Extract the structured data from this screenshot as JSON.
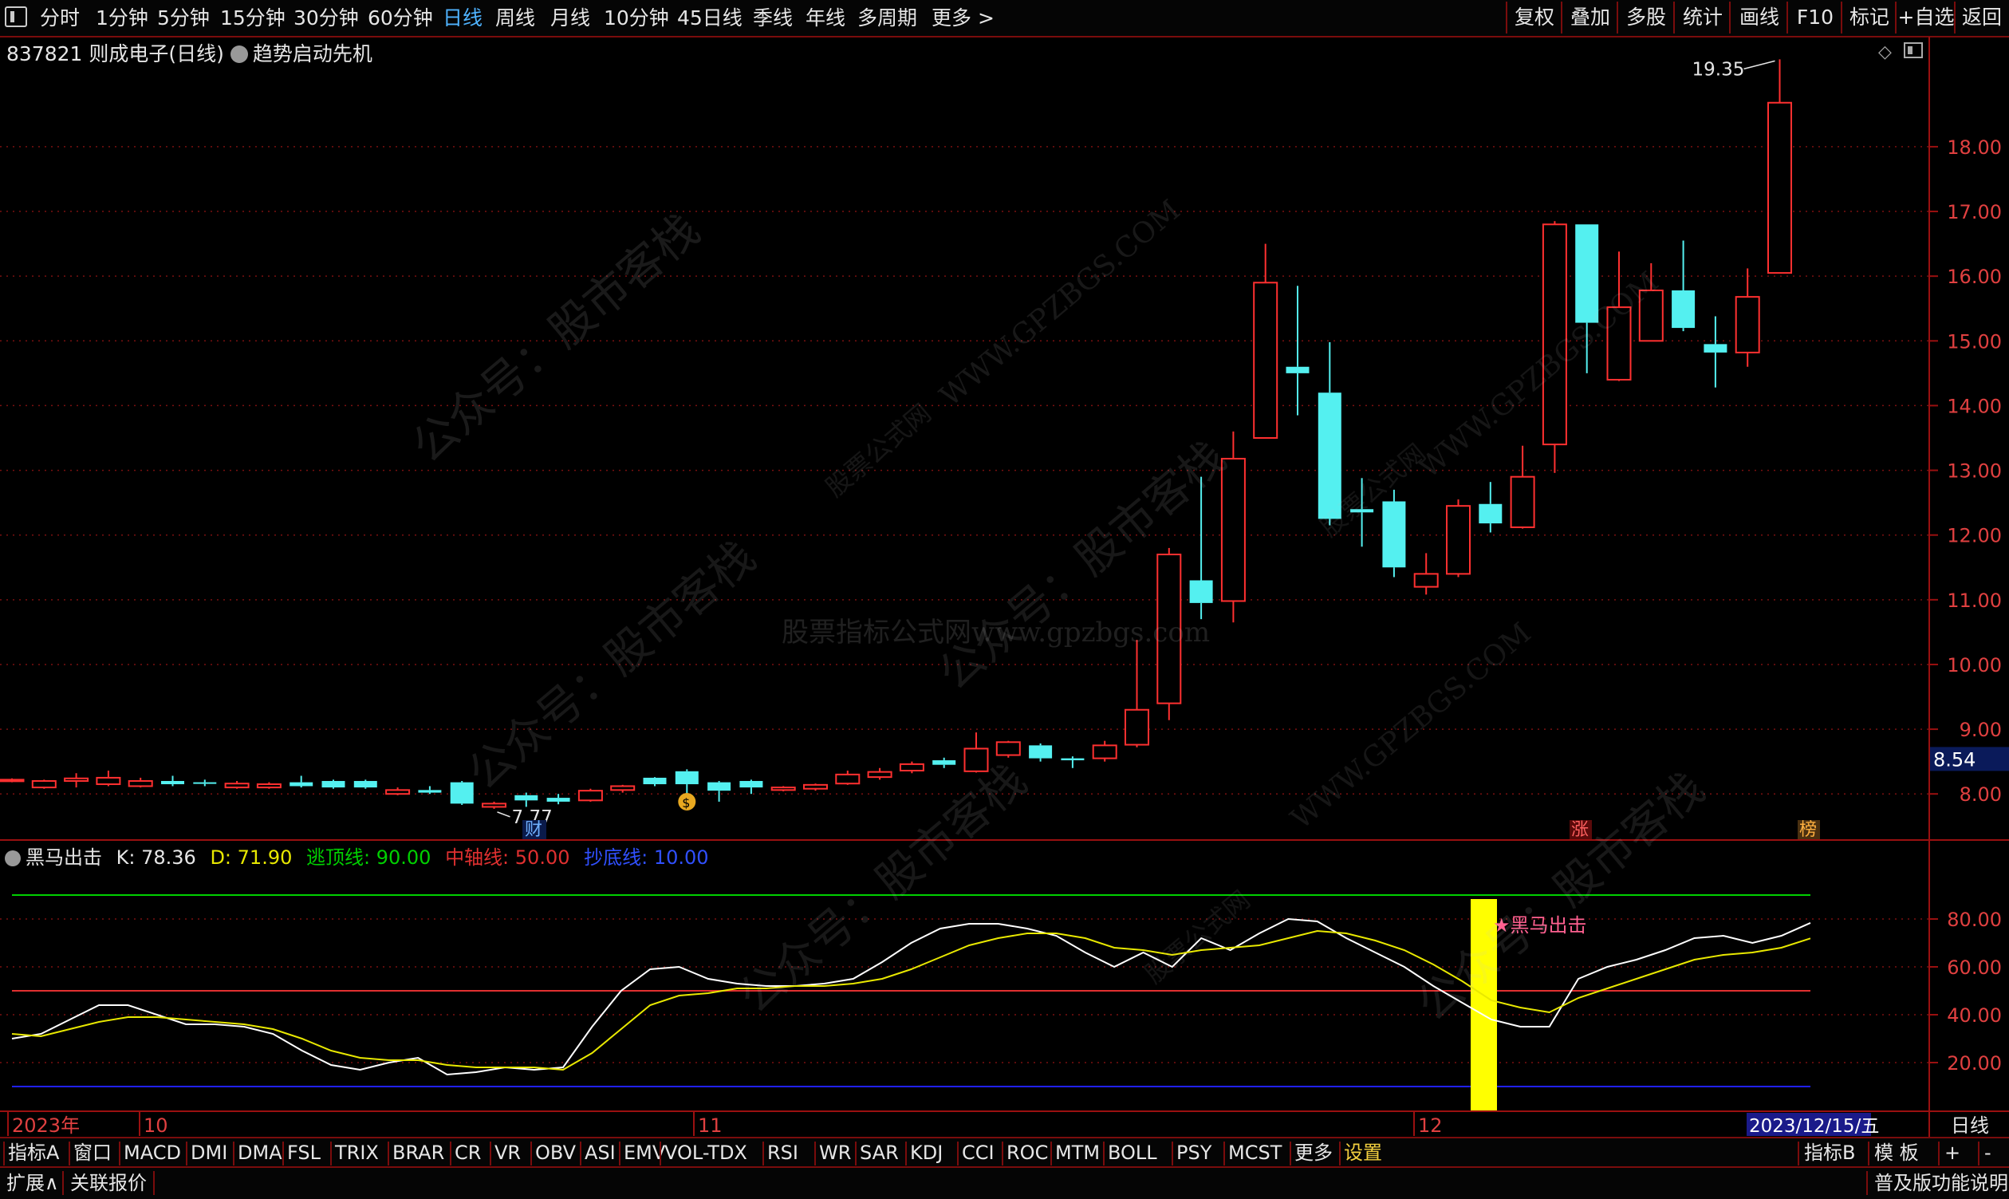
{
  "toolbar": {
    "periods": [
      "分时",
      "1分钟",
      "5分钟",
      "15分钟",
      "30分钟",
      "60分钟",
      "日线",
      "周线",
      "月线",
      "10分钟",
      "45日线",
      "季线",
      "年线",
      "多周期",
      "更多 >"
    ],
    "active_period": "日线",
    "right_buttons": [
      "复权",
      "叠加",
      "多股",
      "统计",
      "画线",
      "F10",
      "标记",
      "+自选",
      "返回"
    ]
  },
  "stock": {
    "title": "837821 则成电子(日线)",
    "indicator_name": "趋势启动先机",
    "current_price_label": "8.54"
  },
  "main_chart": {
    "price_axis": [
      "18.00",
      "17.00",
      "16.00",
      "15.00",
      "14.00",
      "13.00",
      "12.00",
      "11.00",
      "10.00",
      "9.00",
      "8.00"
    ],
    "high_label": "19.35",
    "low_label": "7.77",
    "markers": {
      "cai": "财",
      "zhang": "涨",
      "bang": "榜"
    }
  },
  "indicator": {
    "name": "黑马出击",
    "k_label": "K: 78.36",
    "d_label": "D: 71.90",
    "top_line_label": "逃顶线: 90.00",
    "mid_line_label": "中轴线: 50.00",
    "bottom_line_label": "抄底线: 10.00",
    "axis": [
      "80.00",
      "60.00",
      "40.00",
      "20.00"
    ],
    "signal_label": "★黑马出击",
    "colors": {
      "k": "#ffffff",
      "d": "#e8e800",
      "top": "#00d000",
      "mid": "#e03030",
      "bottom": "#2020ff",
      "signal": "#ffff00"
    }
  },
  "time_axis": {
    "labels": [
      "2023年",
      "10",
      "11",
      "12"
    ],
    "cursor_date": "2023/12/15/五",
    "period_label": "日线"
  },
  "chart_data": [
    {
      "type": "candlestick",
      "title": "",
      "ylim": [
        7.3,
        19.7
      ],
      "candles": [
        {
          "o": 8.2,
          "c": 8.22,
          "h": 8.24,
          "l": 8.18,
          "up": true
        },
        {
          "o": 8.1,
          "c": 8.2,
          "h": 8.22,
          "l": 8.08,
          "up": true
        },
        {
          "o": 8.2,
          "c": 8.24,
          "h": 8.32,
          "l": 8.1,
          "up": true
        },
        {
          "o": 8.15,
          "c": 8.25,
          "h": 8.36,
          "l": 8.12,
          "up": true
        },
        {
          "o": 8.12,
          "c": 8.2,
          "h": 8.25,
          "l": 8.1,
          "up": true
        },
        {
          "o": 8.2,
          "c": 8.15,
          "h": 8.28,
          "l": 8.12,
          "up": false
        },
        {
          "o": 8.18,
          "c": 8.16,
          "h": 8.22,
          "l": 8.12,
          "up": false
        },
        {
          "o": 8.1,
          "c": 8.16,
          "h": 8.2,
          "l": 8.08,
          "up": true
        },
        {
          "o": 8.1,
          "c": 8.15,
          "h": 8.18,
          "l": 8.08,
          "up": true
        },
        {
          "o": 8.18,
          "c": 8.12,
          "h": 8.28,
          "l": 8.1,
          "up": false
        },
        {
          "o": 8.2,
          "c": 8.1,
          "h": 8.22,
          "l": 8.08,
          "up": false
        },
        {
          "o": 8.2,
          "c": 8.1,
          "h": 8.22,
          "l": 8.08,
          "up": false
        },
        {
          "o": 8.0,
          "c": 8.06,
          "h": 8.1,
          "l": 7.98,
          "up": true
        },
        {
          "o": 8.06,
          "c": 8.02,
          "h": 8.12,
          "l": 8.0,
          "up": false
        },
        {
          "o": 8.18,
          "c": 7.85,
          "h": 8.2,
          "l": 7.83,
          "up": false
        },
        {
          "o": 7.8,
          "c": 7.85,
          "h": 7.88,
          "l": 7.77,
          "up": true
        },
        {
          "o": 7.98,
          "c": 7.9,
          "h": 8.02,
          "l": 7.8,
          "up": false
        },
        {
          "o": 7.94,
          "c": 7.88,
          "h": 8.0,
          "l": 7.84,
          "up": false
        },
        {
          "o": 7.9,
          "c": 8.05,
          "h": 8.08,
          "l": 7.88,
          "up": true
        },
        {
          "o": 8.06,
          "c": 8.12,
          "h": 8.14,
          "l": 8.02,
          "up": true
        },
        {
          "o": 8.25,
          "c": 8.15,
          "h": 8.26,
          "l": 8.12,
          "up": false
        },
        {
          "o": 8.35,
          "c": 8.15,
          "h": 8.38,
          "l": 7.95,
          "up": false
        },
        {
          "o": 8.18,
          "c": 8.05,
          "h": 8.2,
          "l": 7.88,
          "up": false
        },
        {
          "o": 8.2,
          "c": 8.1,
          "h": 8.22,
          "l": 8.0,
          "up": false
        },
        {
          "o": 8.06,
          "c": 8.1,
          "h": 8.12,
          "l": 8.04,
          "up": true
        },
        {
          "o": 8.08,
          "c": 8.14,
          "h": 8.16,
          "l": 8.05,
          "up": true
        },
        {
          "o": 8.16,
          "c": 8.3,
          "h": 8.36,
          "l": 8.14,
          "up": true
        },
        {
          "o": 8.26,
          "c": 8.34,
          "h": 8.4,
          "l": 8.22,
          "up": true
        },
        {
          "o": 8.36,
          "c": 8.46,
          "h": 8.5,
          "l": 8.32,
          "up": true
        },
        {
          "o": 8.52,
          "c": 8.45,
          "h": 8.56,
          "l": 8.4,
          "up": false
        },
        {
          "o": 8.35,
          "c": 8.7,
          "h": 8.95,
          "l": 8.33,
          "up": true
        },
        {
          "o": 8.6,
          "c": 8.8,
          "h": 8.82,
          "l": 8.56,
          "up": true
        },
        {
          "o": 8.75,
          "c": 8.55,
          "h": 8.78,
          "l": 8.5,
          "up": false
        },
        {
          "o": 8.55,
          "c": 8.52,
          "h": 8.58,
          "l": 8.4,
          "up": false
        },
        {
          "o": 8.55,
          "c": 8.75,
          "h": 8.82,
          "l": 8.5,
          "up": true
        },
        {
          "o": 8.76,
          "c": 9.3,
          "h": 10.38,
          "l": 8.72,
          "up": true
        },
        {
          "o": 9.4,
          "c": 11.7,
          "h": 11.8,
          "l": 9.14,
          "up": true
        },
        {
          "o": 11.3,
          "c": 10.95,
          "h": 12.9,
          "l": 10.7,
          "up": false
        },
        {
          "o": 10.98,
          "c": 13.18,
          "h": 13.6,
          "l": 10.65,
          "up": true
        },
        {
          "o": 13.5,
          "c": 15.9,
          "h": 16.5,
          "l": 13.5,
          "up": true
        },
        {
          "o": 14.6,
          "c": 14.5,
          "h": 15.85,
          "l": 13.85,
          "up": false
        },
        {
          "o": 14.2,
          "c": 12.25,
          "h": 14.98,
          "l": 12.15,
          "up": false
        },
        {
          "o": 12.4,
          "c": 12.35,
          "h": 12.88,
          "l": 11.82,
          "up": false
        },
        {
          "o": 12.52,
          "c": 11.5,
          "h": 12.7,
          "l": 11.35,
          "up": false
        },
        {
          "o": 11.2,
          "c": 11.4,
          "h": 11.72,
          "l": 11.08,
          "up": true
        },
        {
          "o": 11.4,
          "c": 12.45,
          "h": 12.55,
          "l": 11.35,
          "up": true
        },
        {
          "o": 12.48,
          "c": 12.18,
          "h": 12.82,
          "l": 12.04,
          "up": false
        },
        {
          "o": 12.12,
          "c": 12.9,
          "h": 13.38,
          "l": 12.1,
          "up": true
        },
        {
          "o": 13.4,
          "c": 16.8,
          "h": 16.85,
          "l": 12.96,
          "up": true
        },
        {
          "o": 16.8,
          "c": 15.28,
          "h": 16.8,
          "l": 14.5,
          "up": false
        },
        {
          "o": 14.4,
          "c": 15.52,
          "h": 16.38,
          "l": 14.38,
          "up": true
        },
        {
          "o": 15.0,
          "c": 15.78,
          "h": 16.2,
          "l": 15.0,
          "up": true
        },
        {
          "o": 15.78,
          "c": 15.2,
          "h": 16.55,
          "l": 15.15,
          "up": false
        },
        {
          "o": 14.95,
          "c": 14.82,
          "h": 15.38,
          "l": 14.28,
          "up": false
        },
        {
          "o": 14.82,
          "c": 15.68,
          "h": 16.12,
          "l": 14.6,
          "up": true
        },
        {
          "o": 16.05,
          "c": 18.68,
          "h": 19.35,
          "l": 16.05,
          "up": true
        }
      ]
    },
    {
      "type": "line",
      "title": "黑马出击",
      "ylim": [
        0,
        100
      ],
      "reference_lines": [
        {
          "name": "逃顶线",
          "value": 90
        },
        {
          "name": "中轴线",
          "value": 50
        },
        {
          "name": "抄底线",
          "value": 10
        }
      ],
      "series": [
        {
          "name": "K",
          "values": [
            30,
            32,
            38,
            44,
            44,
            40,
            36,
            36,
            35,
            32,
            25,
            19,
            17,
            20,
            22,
            15,
            16,
            18,
            17,
            18,
            35,
            50,
            59,
            60,
            55,
            53,
            52,
            52,
            53,
            55,
            62,
            70,
            76,
            78,
            78,
            76,
            73,
            66,
            60,
            66,
            60,
            72,
            67,
            74,
            80,
            79,
            72,
            66,
            60,
            52,
            45,
            38,
            35,
            35,
            55,
            60,
            63,
            67,
            72,
            73,
            70,
            73,
            78.36
          ]
        },
        {
          "name": "D",
          "values": [
            32,
            31,
            34,
            37,
            39,
            39,
            38,
            37,
            36,
            34,
            30,
            25,
            22,
            21,
            21,
            19,
            18,
            18,
            18,
            17,
            24,
            34,
            44,
            48,
            49,
            51,
            51,
            52,
            52,
            53,
            55,
            59,
            64,
            69,
            72,
            74,
            74,
            72,
            68,
            67,
            65,
            67,
            68,
            69,
            72,
            75,
            74,
            71,
            67,
            61,
            54,
            46,
            43,
            41,
            47,
            51,
            55,
            59,
            63,
            65,
            66,
            68,
            71.9
          ]
        }
      ],
      "signals": [
        {
          "label": "★黑马出击",
          "index": 49
        }
      ]
    }
  ],
  "bottom_bar": {
    "tabs": [
      "指标A",
      "窗口",
      "MACD",
      "DMI",
      "DMA",
      "FSL",
      "TRIX",
      "BRAR",
      "CR",
      "VR",
      "OBV",
      "ASI",
      "EMV",
      "VOL-TDX",
      "RSI",
      "WR",
      "SAR",
      "KDJ",
      "CCI",
      "ROC",
      "MTM",
      "BOLL",
      "PSY",
      "MCST",
      "更多",
      "设置"
    ],
    "active_tab": "设置",
    "right_tabs": [
      "指标B",
      "模 板",
      "+",
      "-"
    ]
  },
  "status_bar": {
    "left": [
      "扩展∧",
      "关联报价"
    ],
    "right": "普及版功能说明"
  },
  "watermarks": [
    "公众号：股市客栈",
    "WWW.GPZBGS.COM",
    "股票公式网",
    "股票指标公式网www.gpzbgs.com"
  ]
}
